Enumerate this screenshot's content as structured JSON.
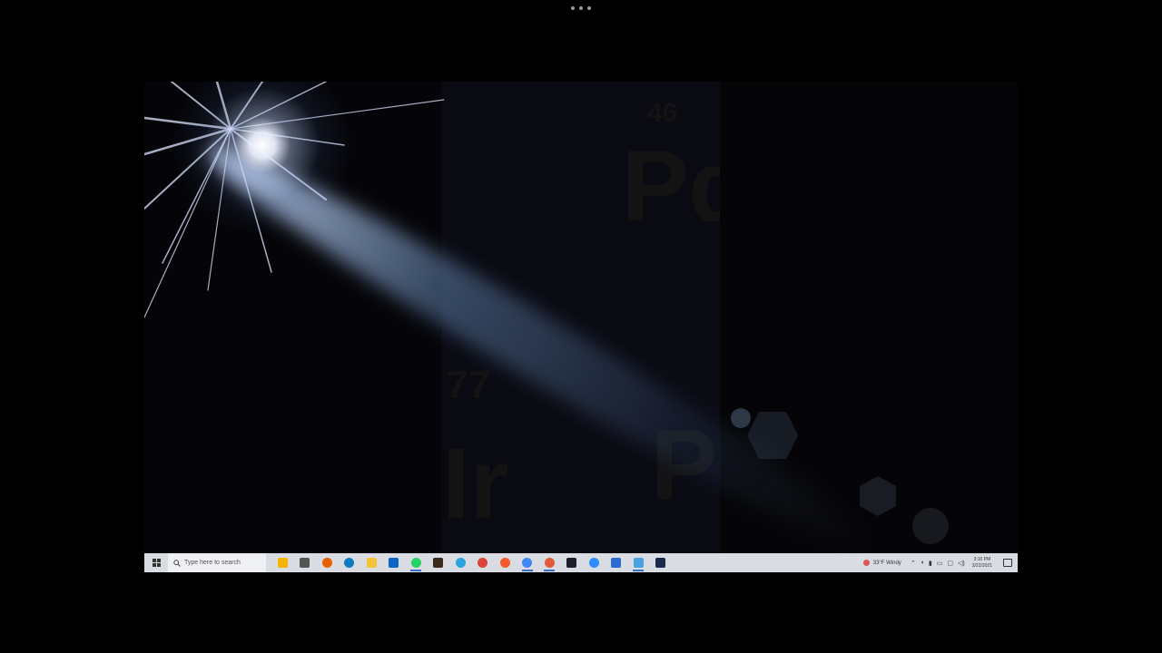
{
  "window": {
    "menu_icon": "more-dots-icon"
  },
  "wallpaper": {
    "ghost_letters": [
      {
        "text": "46"
      },
      {
        "text": "Pd"
      },
      {
        "text": "77"
      },
      {
        "text": "Ir"
      },
      {
        "text": "P"
      }
    ]
  },
  "taskbar": {
    "start_icon": "windows-logo-icon",
    "search": {
      "placeholder": "Type here to search",
      "icon": "search-icon"
    },
    "apps": [
      {
        "name": "cortana-icon",
        "color": "#f4b400",
        "open": false
      },
      {
        "name": "task-view-icon",
        "color": "#555555",
        "open": false
      },
      {
        "name": "firefox-icon",
        "color": "#e66000",
        "open": false
      },
      {
        "name": "edge-icon",
        "color": "#0f7cc2",
        "open": false
      },
      {
        "name": "file-explorer-icon",
        "color": "#f3c33a",
        "open": false
      },
      {
        "name": "outlook-icon",
        "color": "#0a64c2",
        "open": false
      },
      {
        "name": "whatsapp-icon",
        "color": "#25d366",
        "open": true
      },
      {
        "name": "calculator-icon",
        "color": "#3a2a1a",
        "open": false
      },
      {
        "name": "telegram-icon",
        "color": "#2aa3de",
        "open": false
      },
      {
        "name": "chrome-icon",
        "color": "#db4437",
        "open": false
      },
      {
        "name": "brave-icon",
        "color": "#f25a2a",
        "open": false
      },
      {
        "name": "chrome-profile-icon",
        "color": "#4285f4",
        "open": true
      },
      {
        "name": "chrome-alt-icon",
        "color": "#e05a3a",
        "open": true
      },
      {
        "name": "terminal-icon",
        "color": "#1e1e2a",
        "open": false
      },
      {
        "name": "zoom-icon",
        "color": "#2d8cff",
        "open": false
      },
      {
        "name": "photos-icon",
        "color": "#2a6ad1",
        "open": false
      },
      {
        "name": "remote-desktop-icon",
        "color": "#4aa3e0",
        "open": true
      },
      {
        "name": "powershell-icon",
        "color": "#1a2a4a",
        "open": false
      }
    ],
    "tray": {
      "weather": "33°F  Windy",
      "weather_icon": "weather-icon",
      "chevron_icon": "chevron-up-icon",
      "time": "3:10 PM",
      "date": "3/22/2021",
      "notification_icon": "notification-icon"
    }
  }
}
